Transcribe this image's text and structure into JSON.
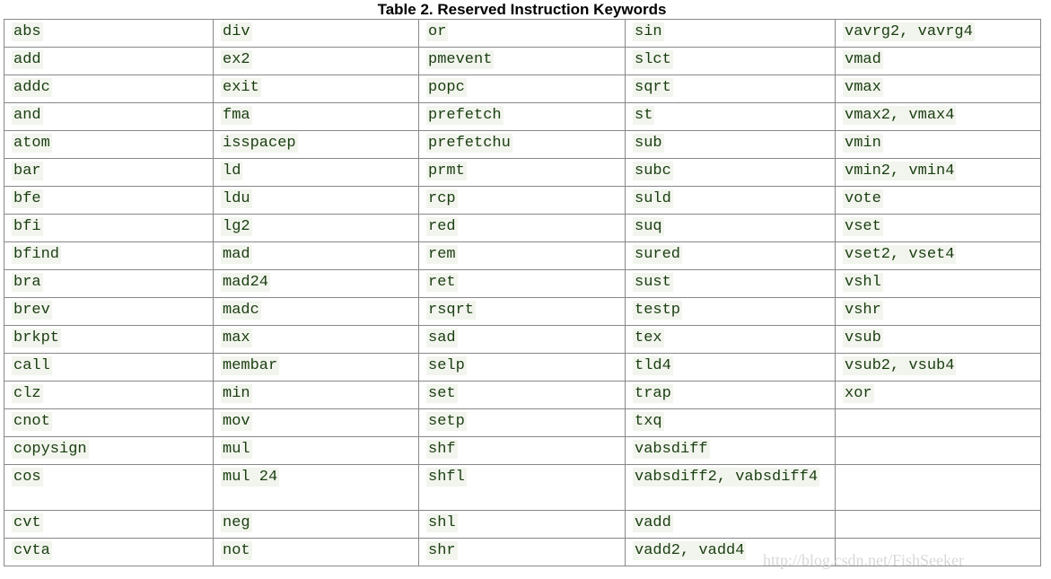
{
  "caption": "Table 2. Reserved Instruction Keywords",
  "rows": [
    [
      "abs",
      "div",
      "or",
      "sin",
      "vavrg2, vavrg4"
    ],
    [
      "add",
      "ex2",
      "pmevent",
      "slct",
      "vmad"
    ],
    [
      "addc",
      "exit",
      "popc",
      "sqrt",
      "vmax"
    ],
    [
      "and",
      "fma",
      "prefetch",
      "st",
      "vmax2, vmax4"
    ],
    [
      "atom",
      "isspacep",
      "prefetchu",
      "sub",
      "vmin"
    ],
    [
      "bar",
      "ld",
      "prmt",
      "subc",
      "vmin2, vmin4"
    ],
    [
      "bfe",
      "ldu",
      "rcp",
      "suld",
      "vote"
    ],
    [
      "bfi",
      "lg2",
      "red",
      "suq",
      "vset"
    ],
    [
      "bfind",
      "mad",
      "rem",
      "sured",
      "vset2, vset4"
    ],
    [
      "bra",
      "mad24",
      "ret",
      "sust",
      "vshl"
    ],
    [
      "brev",
      "madc",
      "rsqrt",
      "testp",
      "vshr"
    ],
    [
      "brkpt",
      "max",
      "sad",
      "tex",
      "vsub"
    ],
    [
      "call",
      "membar",
      "selp",
      "tld4",
      "vsub2, vsub4"
    ],
    [
      "clz",
      "min",
      "set",
      "trap",
      "xor"
    ],
    [
      "cnot",
      "mov",
      "setp",
      "txq",
      ""
    ],
    [
      "copysign",
      "mul",
      "shf",
      "vabsdiff",
      ""
    ],
    [
      "cos",
      "mul 24",
      "shfl",
      "vabsdiff2, vabsdiff4",
      ""
    ],
    [
      "cvt",
      "neg",
      "shl",
      "vadd",
      ""
    ],
    [
      "cvta",
      "not",
      "shr",
      "vadd2, vadd4",
      ""
    ]
  ],
  "watermark": "http://blog.csdn.net/FishSeeker"
}
